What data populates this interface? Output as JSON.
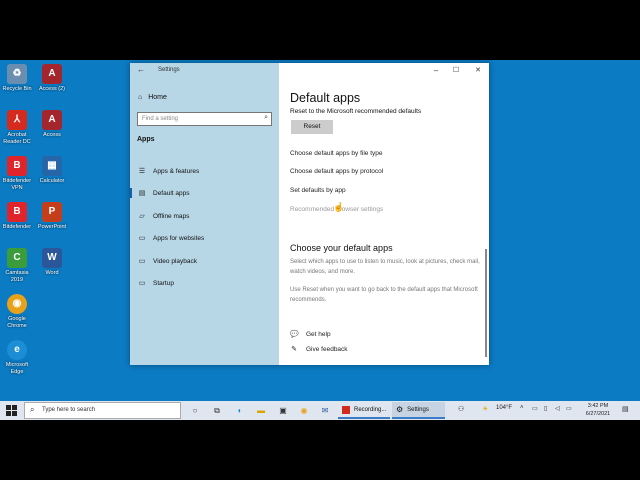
{
  "desktop": {
    "icons": [
      {
        "label": "Recycle Bin",
        "glyph": "♻",
        "color": "#5a7fa0"
      },
      {
        "label": "Access (2)",
        "glyph": "A",
        "color": "#a4262c"
      },
      {
        "label": "Acrobat Reader DC",
        "glyph": "⅄",
        "color": "#d42b1e"
      },
      {
        "label": "Access",
        "glyph": "A",
        "color": "#a4262c"
      },
      {
        "label": "Bitdefender VPN",
        "glyph": "B",
        "color": "#e0242b"
      },
      {
        "label": "Calculator",
        "glyph": "▦",
        "color": "#2565a8"
      },
      {
        "label": "Bitdefender",
        "glyph": "B",
        "color": "#e0242b"
      },
      {
        "label": "PowerPoint",
        "glyph": "P",
        "color": "#c43e1c"
      },
      {
        "label": "Camtasia 2019",
        "glyph": "C",
        "color": "#3a9c3a"
      },
      {
        "label": "Word",
        "glyph": "W",
        "color": "#2b579a"
      },
      {
        "label": "Google Chrome",
        "glyph": "◉",
        "color": "#e8a21a"
      },
      {
        "label": "Microsoft Edge",
        "glyph": "e",
        "color": "#1b8ed6"
      }
    ]
  },
  "window": {
    "title": "Settings",
    "back_glyph": "←",
    "min_glyph": "–",
    "max_glyph": "☐",
    "close_glyph": "✕"
  },
  "sidebar": {
    "home_label": "Home",
    "search_placeholder": "Find a setting",
    "section_title": "Apps",
    "items": [
      {
        "label": "Apps & features",
        "icon": "list-icon",
        "glyph": "☰"
      },
      {
        "label": "Default apps",
        "icon": "default-apps-icon",
        "glyph": "▤"
      },
      {
        "label": "Offline maps",
        "icon": "map-icon",
        "glyph": "▱"
      },
      {
        "label": "Apps for websites",
        "icon": "apps-websites-icon",
        "glyph": "▭"
      },
      {
        "label": "Video playback",
        "icon": "video-icon",
        "glyph": "▭"
      },
      {
        "label": "Startup",
        "icon": "startup-icon",
        "glyph": "▭"
      }
    ]
  },
  "main": {
    "title": "Default apps",
    "reset_label": "Reset to the Microsoft recommended defaults",
    "reset_button": "Reset",
    "links": [
      "Choose default apps by file type",
      "Choose default apps by protocol",
      "Set defaults by app",
      "Recommended browser settings"
    ],
    "section_title": "Choose your default apps",
    "para1": "Select which apps to use to listen to music, look at pictures, check mail, watch videos, and more.",
    "para2": "Use Reset when you want to go back to the default apps that Microsoft recommends.",
    "help_label": "Get help",
    "feedback_label": "Give feedback"
  },
  "taskbar": {
    "search_placeholder": "Type here to search",
    "recording_label": "Recording...",
    "settings_label": "Settings",
    "weather": "104°F",
    "time": "3:42 PM",
    "date": "6/27/2021"
  }
}
